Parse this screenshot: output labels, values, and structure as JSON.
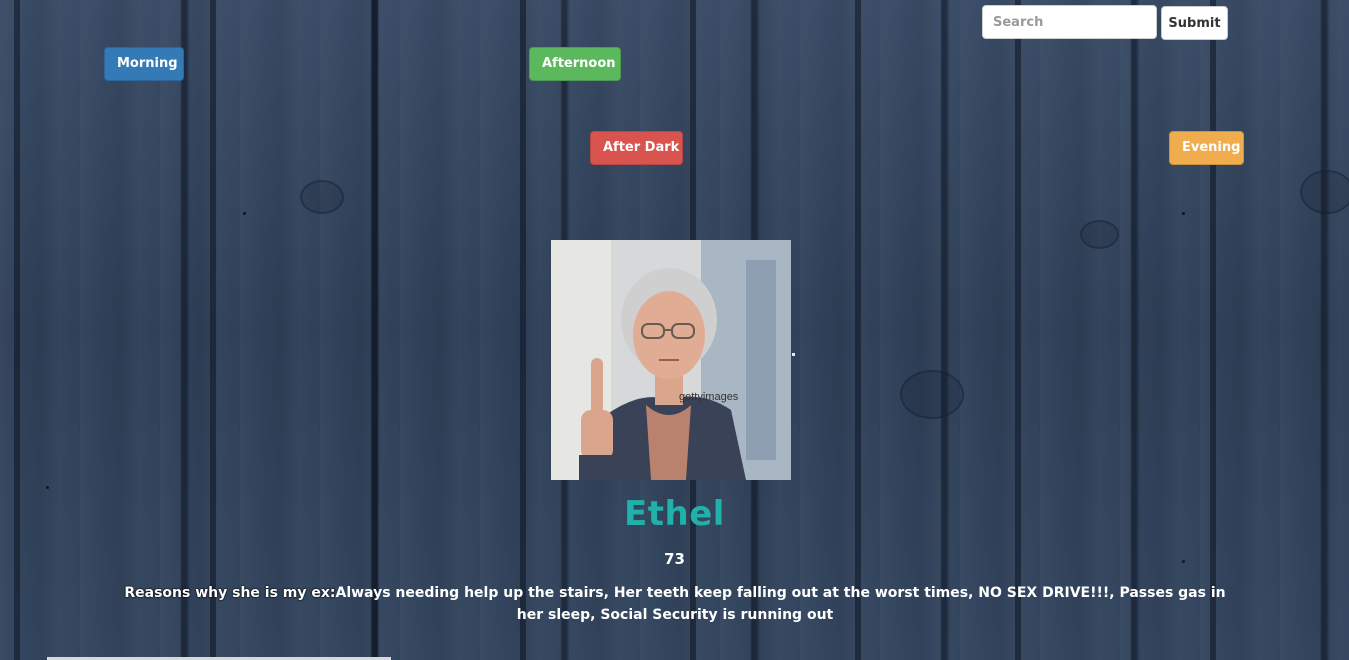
{
  "nav": {
    "morning": "Morning",
    "afternoon": "Afternoon",
    "after_dark": "After Dark",
    "evening": "Evening"
  },
  "search": {
    "placeholder": "Search",
    "value": "",
    "submit_label": "Submit"
  },
  "profile": {
    "image_watermark": "gettyimages",
    "name": "Ethel",
    "age": "73",
    "reasons_label": "Reasons why she is my ex:",
    "reasons_text": "Always needing help up the stairs, Her teeth keep falling out at the worst times, NO SEX DRIVE!!!, Passes gas in her sleep, Social Security is running out"
  },
  "colors": {
    "morning": "#337ab7",
    "afternoon": "#5cb85c",
    "after_dark": "#d9534f",
    "evening": "#f0ad4e",
    "name": "#20b2aa"
  }
}
